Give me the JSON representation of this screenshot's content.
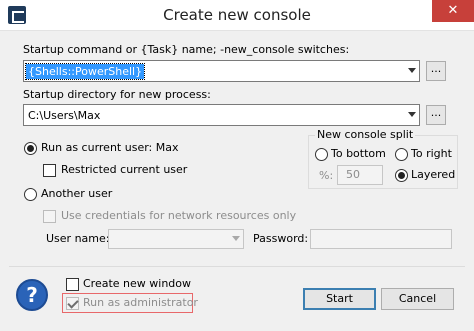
{
  "window": {
    "title": "Create new console",
    "close_glyph": "✕"
  },
  "startup_command": {
    "label": "Startup command or {Task} name; -new_console switches:",
    "value": "{Shells::PowerShell}",
    "browse_label": "..."
  },
  "startup_directory": {
    "label": "Startup directory for new process:",
    "value": "C:\\Users\\Max",
    "browse_label": "..."
  },
  "run_as": {
    "current_user_label": "Run as current user: Max",
    "current_user_selected": true,
    "restricted_label": "Restricted current user",
    "restricted_checked": false,
    "another_user_label": "Another user",
    "another_user_selected": false,
    "network_credentials_label": "Use credentials for network resources only",
    "user_name_label": "User name:",
    "password_label": "Password:"
  },
  "split": {
    "title": "New console split",
    "to_bottom_label": "To bottom",
    "to_right_label": "To right",
    "percent_label": "%:",
    "percent_value": "50",
    "layered_label": "Layered",
    "selected": "Layered"
  },
  "footer": {
    "help_glyph": "?",
    "create_new_window_label": "Create new window",
    "create_new_window_checked": false,
    "run_as_admin_label": "Run as administrator",
    "run_as_admin_checked": true,
    "start_label": "Start",
    "cancel_label": "Cancel"
  },
  "colors": {
    "accent": "#3399ff",
    "highlight_border": "#e8686a",
    "close_button": "#c7403a",
    "help_icon": "#2a63b8"
  }
}
